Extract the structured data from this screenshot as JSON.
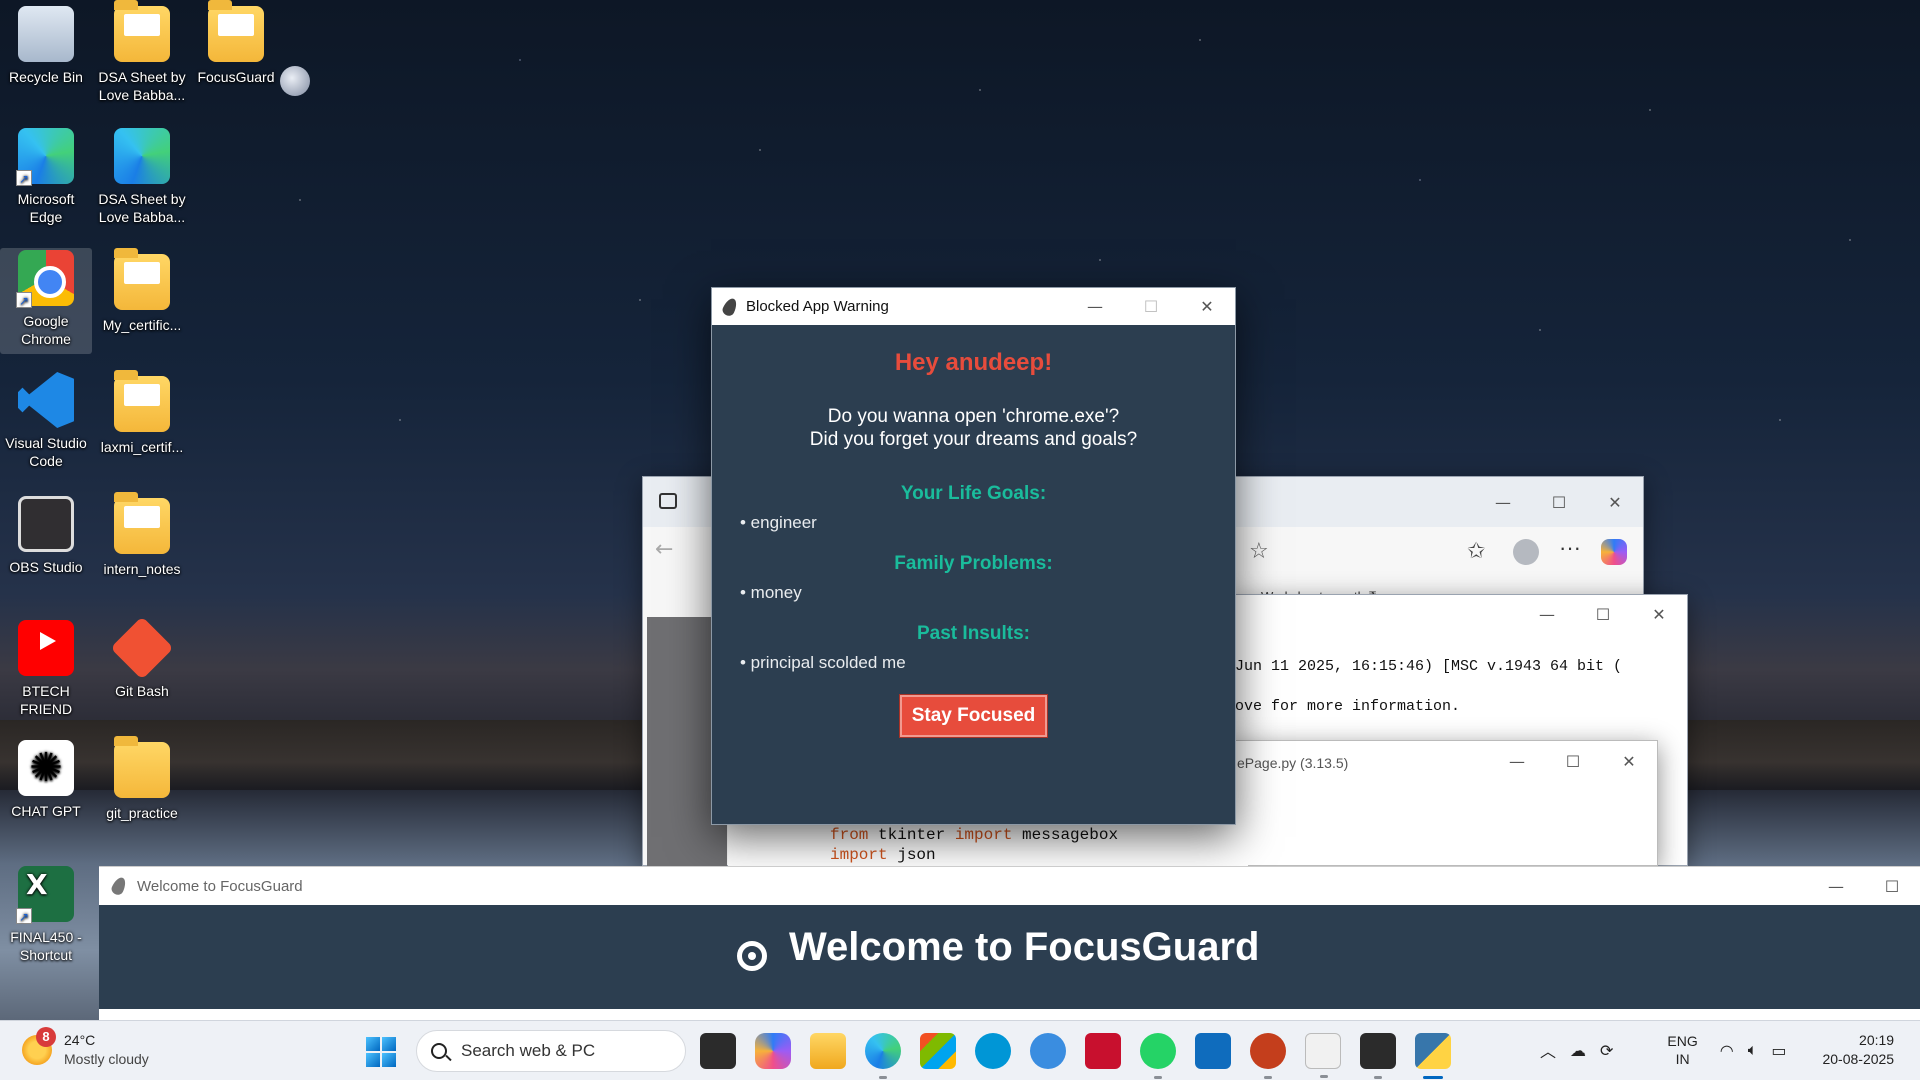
{
  "desktop": {
    "icons": [
      {
        "label": "Recycle Bin"
      },
      {
        "label": "DSA Sheet by Love Babba..."
      },
      {
        "label": "FocusGuard"
      },
      {
        "label": "Microsoft Edge"
      },
      {
        "label": "DSA Sheet by Love Babba..."
      },
      {
        "label": "Google Chrome"
      },
      {
        "label": "My_certific..."
      },
      {
        "label": "Visual Studio Code"
      },
      {
        "label": "laxmi_certif..."
      },
      {
        "label": "OBS Studio"
      },
      {
        "label": "intern_notes"
      },
      {
        "label": "BTECH FRIEND"
      },
      {
        "label": "Git Bash"
      },
      {
        "label": "CHAT GPT"
      },
      {
        "label": "git_practice"
      },
      {
        "label": "FINAL450 - Shortcut"
      }
    ]
  },
  "browser": {
    "bookmark": "Worksheets worth ₹"
  },
  "python_shell": {
    "line1": "Jun 11 2025, 16:15:46) [MSC v.1943 64 bit (",
    "line2": "ove for more information."
  },
  "idle": {
    "title": "ePage.py (3.13.5)"
  },
  "code": {
    "line1_kw1": "from",
    "line1_mod": " tkinter ",
    "line1_kw2": "import",
    "line1_name": " messagebox",
    "line2_kw": "import",
    "line2_name": " json"
  },
  "warning_dialog": {
    "title": "Blocked App Warning",
    "greeting": "Hey anudeep!",
    "question_line1": "Do you wanna open 'chrome.exe'?",
    "question_line2": "Did you forget your dreams and goals?",
    "sections": [
      {
        "heading": "Your Life Goals:",
        "item": "• engineer"
      },
      {
        "heading": "Family Problems:",
        "item": "• money"
      },
      {
        "heading": "Past Insults:",
        "item": "• principal scolded me"
      }
    ],
    "button_label": "Stay Focused",
    "colors": {
      "background": "#2c3e50",
      "greeting": "#e74c3c",
      "heading": "#1abc9c",
      "button": "#e74c3c"
    }
  },
  "welcome_window": {
    "title": "Welcome to FocusGuard",
    "heading": "Welcome to FocusGuard"
  },
  "taskbar": {
    "weather_temp": "24°C",
    "weather_desc": "Mostly cloudy",
    "weather_badge": "8",
    "search_placeholder": "Search web & PC",
    "lang_line1": "ENG",
    "lang_line2": "IN",
    "time": "20:19",
    "date": "20-08-2025"
  }
}
